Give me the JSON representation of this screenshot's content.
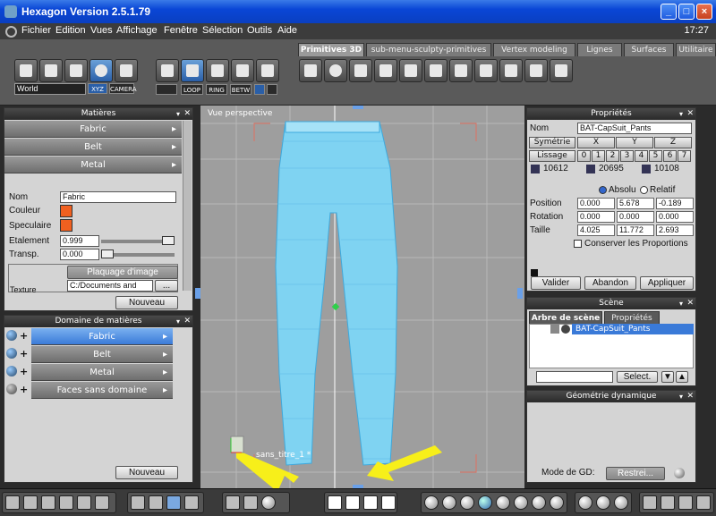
{
  "window": {
    "title": "Hexagon Version 2.5.1.79",
    "min": "_",
    "max": "□",
    "close": "×"
  },
  "menu": {
    "items": [
      "Fichier",
      "Edition",
      "Vues",
      "Affichage",
      "Fenêtre",
      "Sélection",
      "Outils",
      "Aide"
    ],
    "clock": "17:27"
  },
  "toolbar": {
    "world_select": "World",
    "xyz": "XYZ",
    "camera": "CAMERA",
    "loop": "LOOP",
    "ring": "RING",
    "betw": "BETW",
    "tabs": [
      "Primitives 3D",
      "sub-menu-sculpty-primitives",
      "Vertex modeling",
      "Lignes",
      "Surfaces",
      "Utilitaire"
    ]
  },
  "materials": {
    "title": "Matières",
    "rows": [
      "Fabric",
      "Belt",
      "Metal"
    ],
    "nom_label": "Nom",
    "nom_value": "Fabric",
    "couleur_label": "Couleur",
    "speculaire_label": "Speculaire",
    "etalement_label": "Etalement",
    "etalement_value": "0.999",
    "transp_label": "Transp.",
    "transp_value": "0.000",
    "texture_label": "Texture",
    "mapping_value": "Plaquage d'image",
    "path_value": "C:/Documents and",
    "browse": "...",
    "new_button": "Nouveau"
  },
  "domain": {
    "title": "Domaine de matières",
    "rows": [
      "Fabric",
      "Belt",
      "Metal",
      "Faces sans domaine"
    ],
    "new_button": "Nouveau"
  },
  "viewport": {
    "label": "Vue perspective",
    "object_name": "sans_titre_1 *"
  },
  "properties": {
    "title": "Propriétés",
    "nom_label": "Nom",
    "nom_value": "BAT-CapSuit_Pants",
    "symetrie": "Symétrie",
    "axes": [
      "X",
      "Y",
      "Z"
    ],
    "lissage": "Lissage",
    "levels": [
      "0",
      "1",
      "2",
      "3",
      "4",
      "5",
      "6",
      "7"
    ],
    "counts": [
      "10612",
      "20695",
      "10108"
    ],
    "absolu": "Absolu",
    "relatif": "Relatif",
    "position_label": "Position",
    "position": [
      "0.000",
      "5.678",
      "-0.189"
    ],
    "rotation_label": "Rotation",
    "rotation": [
      "0.000",
      "0.000",
      "0.000"
    ],
    "taille_label": "Taille",
    "taille": [
      "4.025",
      "11.772",
      "2.693"
    ],
    "conserver": "Conserver les Proportions",
    "valider": "Valider",
    "abandon": "Abandon",
    "appliquer": "Appliquer"
  },
  "scene": {
    "title": "Scène",
    "tab_tree": "Arbre de scène",
    "tab_props": "Propriétés",
    "item": "BAT-CapSuit_Pants",
    "select_button": "Select."
  },
  "dyngeo": {
    "title": "Géométrie dynamique",
    "mode_label": "Mode de GD:",
    "mode_value": "Restrei..."
  },
  "colors": {
    "accent": "#3a7ad8",
    "swatch": "#f06020",
    "pants": "#7fd3f2",
    "arrow": "#f7ef1a"
  }
}
